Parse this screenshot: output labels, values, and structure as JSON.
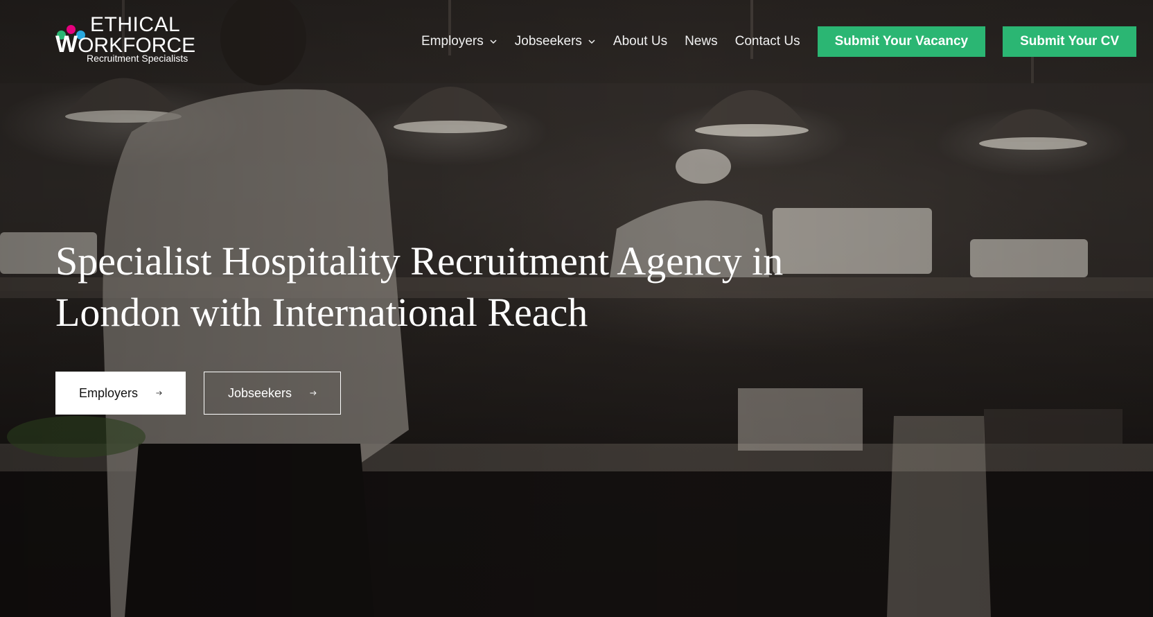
{
  "logo": {
    "line1": "ETHICAL",
    "line2_initial": "W",
    "line2_rest": "ORKFORCE",
    "line3": "Recruitment Specialists",
    "dot_colors": [
      "#2bb673",
      "#e6007e",
      "#29a9e0"
    ]
  },
  "nav": {
    "items": [
      {
        "label": "Employers",
        "dropdown": true
      },
      {
        "label": "Jobseekers",
        "dropdown": true
      },
      {
        "label": "About Us",
        "dropdown": false
      },
      {
        "label": "News",
        "dropdown": false
      },
      {
        "label": "Contact Us",
        "dropdown": false
      }
    ],
    "cta_vacancy": "Submit Your Vacancy",
    "cta_cv": "Submit Your CV"
  },
  "hero": {
    "headline": "Specialist Hospitality Recruitment Agency in London with International Reach",
    "btn_employers": "Employers",
    "btn_jobseekers": "Jobseekers"
  },
  "colors": {
    "accent": "#2bb673",
    "text": "#ffffff"
  },
  "icons": {
    "dropdown": "chevron-down-icon",
    "button_arrow": "arrow-right-icon"
  }
}
